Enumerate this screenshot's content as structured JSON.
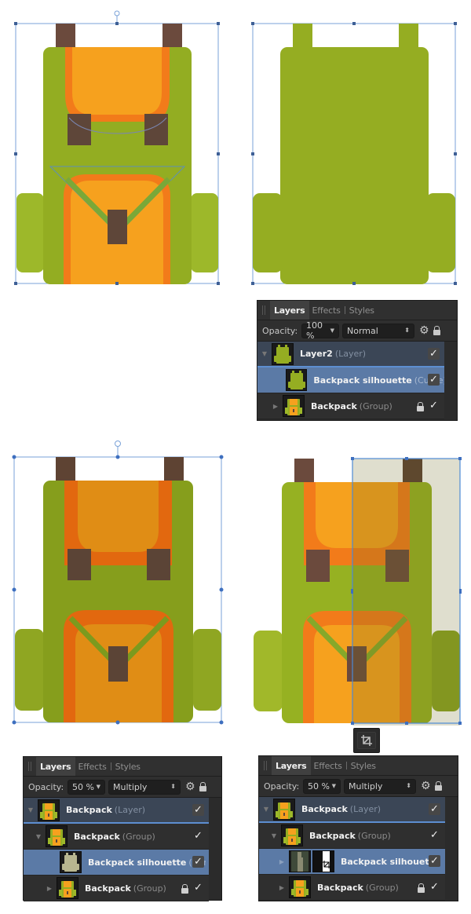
{
  "colors": {
    "bag_green": "#93ad22",
    "side_pocket_green": "#9db82a",
    "strap_orange": "#f27b1a",
    "flap_orange": "#f6a11e",
    "buckle_brown": "#5e4639",
    "handle_brown": "#6b4a3d",
    "selection_blue": "#5b8ed6",
    "panel_bg": "#2b2b2b",
    "selected_row": "#5b7aa6"
  },
  "panels": [
    {
      "id": "panel-1",
      "tabs": [
        {
          "label": "Layers",
          "active": true
        },
        {
          "label": "Effects",
          "active": false
        },
        {
          "label": "Styles",
          "active": false
        }
      ],
      "opacity_label": "Opacity:",
      "opacity_value": "100 %",
      "blend_mode": "Normal",
      "layers": [
        {
          "name": "Layer2",
          "type": "(Layer)",
          "visible": true,
          "locked": false
        },
        {
          "name": "Backpack silhouette",
          "type": "(Curve)",
          "visible": true,
          "locked": false
        },
        {
          "name": "Backpack",
          "type": "(Group)",
          "visible": true,
          "locked": true
        }
      ]
    },
    {
      "id": "panel-2",
      "tabs": [
        {
          "label": "Layers",
          "active": true
        },
        {
          "label": "Effects",
          "active": false
        },
        {
          "label": "Styles",
          "active": false
        }
      ],
      "opacity_label": "Opacity:",
      "opacity_value": "50 %",
      "blend_mode": "Multiply",
      "layers": [
        {
          "name": "Backpack",
          "type": "(Layer)",
          "visible": true,
          "locked": false
        },
        {
          "name": "Backpack",
          "type": "(Group)",
          "visible": true,
          "locked": false
        },
        {
          "name": "Backpack silhouette",
          "type": "(Curve)",
          "visible": true,
          "locked": false
        },
        {
          "name": "Backpack",
          "type": "(Group)",
          "visible": true,
          "locked": true
        }
      ]
    },
    {
      "id": "panel-3",
      "tabs": [
        {
          "label": "Layers",
          "active": true
        },
        {
          "label": "Effects",
          "active": false
        },
        {
          "label": "Styles",
          "active": false
        }
      ],
      "opacity_label": "Opacity:",
      "opacity_value": "50 %",
      "blend_mode": "Multiply",
      "layers": [
        {
          "name": "Backpack",
          "type": "(Layer)",
          "visible": true,
          "locked": false
        },
        {
          "name": "Backpack",
          "type": "(Group)",
          "visible": true,
          "locked": false
        },
        {
          "name": "Backpack silhouette",
          "type": "",
          "visible": true,
          "locked": false
        },
        {
          "name": "Backpack",
          "type": "(Group)",
          "visible": true,
          "locked": true
        }
      ]
    }
  ],
  "icons": {
    "check": "✓",
    "gear": "⚙",
    "expand_down": "▼",
    "expand_right": "▶",
    "updown": "⬍",
    "crop": "⌗"
  }
}
